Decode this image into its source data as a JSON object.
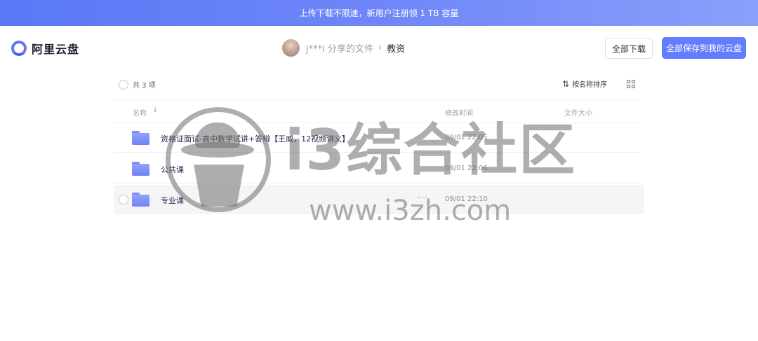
{
  "banner": {
    "text": "上传下载不限速，新用户注册领 1 TB 容量"
  },
  "header": {
    "logo_text": "阿里云盘",
    "sharer": "j***i 分享的文件",
    "separator": "›",
    "current_folder": "教资",
    "download_all_label": "全部下载",
    "save_all_label": "全部保存到我的云盘"
  },
  "toolbar": {
    "item_count": "共 3 项",
    "sort_icon": "⇅",
    "sort_label": "按名称排序",
    "view_icon": "grid-view-icon"
  },
  "table": {
    "columns": {
      "name": "名称",
      "name_sort_arrow": "↓",
      "modified": "修改时间",
      "size": "文件大小"
    },
    "rows": [
      {
        "name": "资格证面试-高中数学试讲+答辩【王威，12视频讲义】",
        "modified": "09/01 22:05",
        "size": "",
        "icon": "folder-icon"
      },
      {
        "name": "公共课",
        "modified": "09/01 22:06",
        "size": "",
        "icon": "folder-icon"
      },
      {
        "name": "专业课",
        "modified": "09/01 22:10",
        "size": "",
        "icon": "folder-icon",
        "more": "···"
      }
    ]
  },
  "watermark": {
    "brand": "i3综合社区",
    "url": "www.i3zh.com"
  },
  "colors": {
    "accent": "#637dff",
    "banner_start": "#5a78f6",
    "banner_end": "#8aa0fb",
    "folder": "#7d8df5"
  }
}
